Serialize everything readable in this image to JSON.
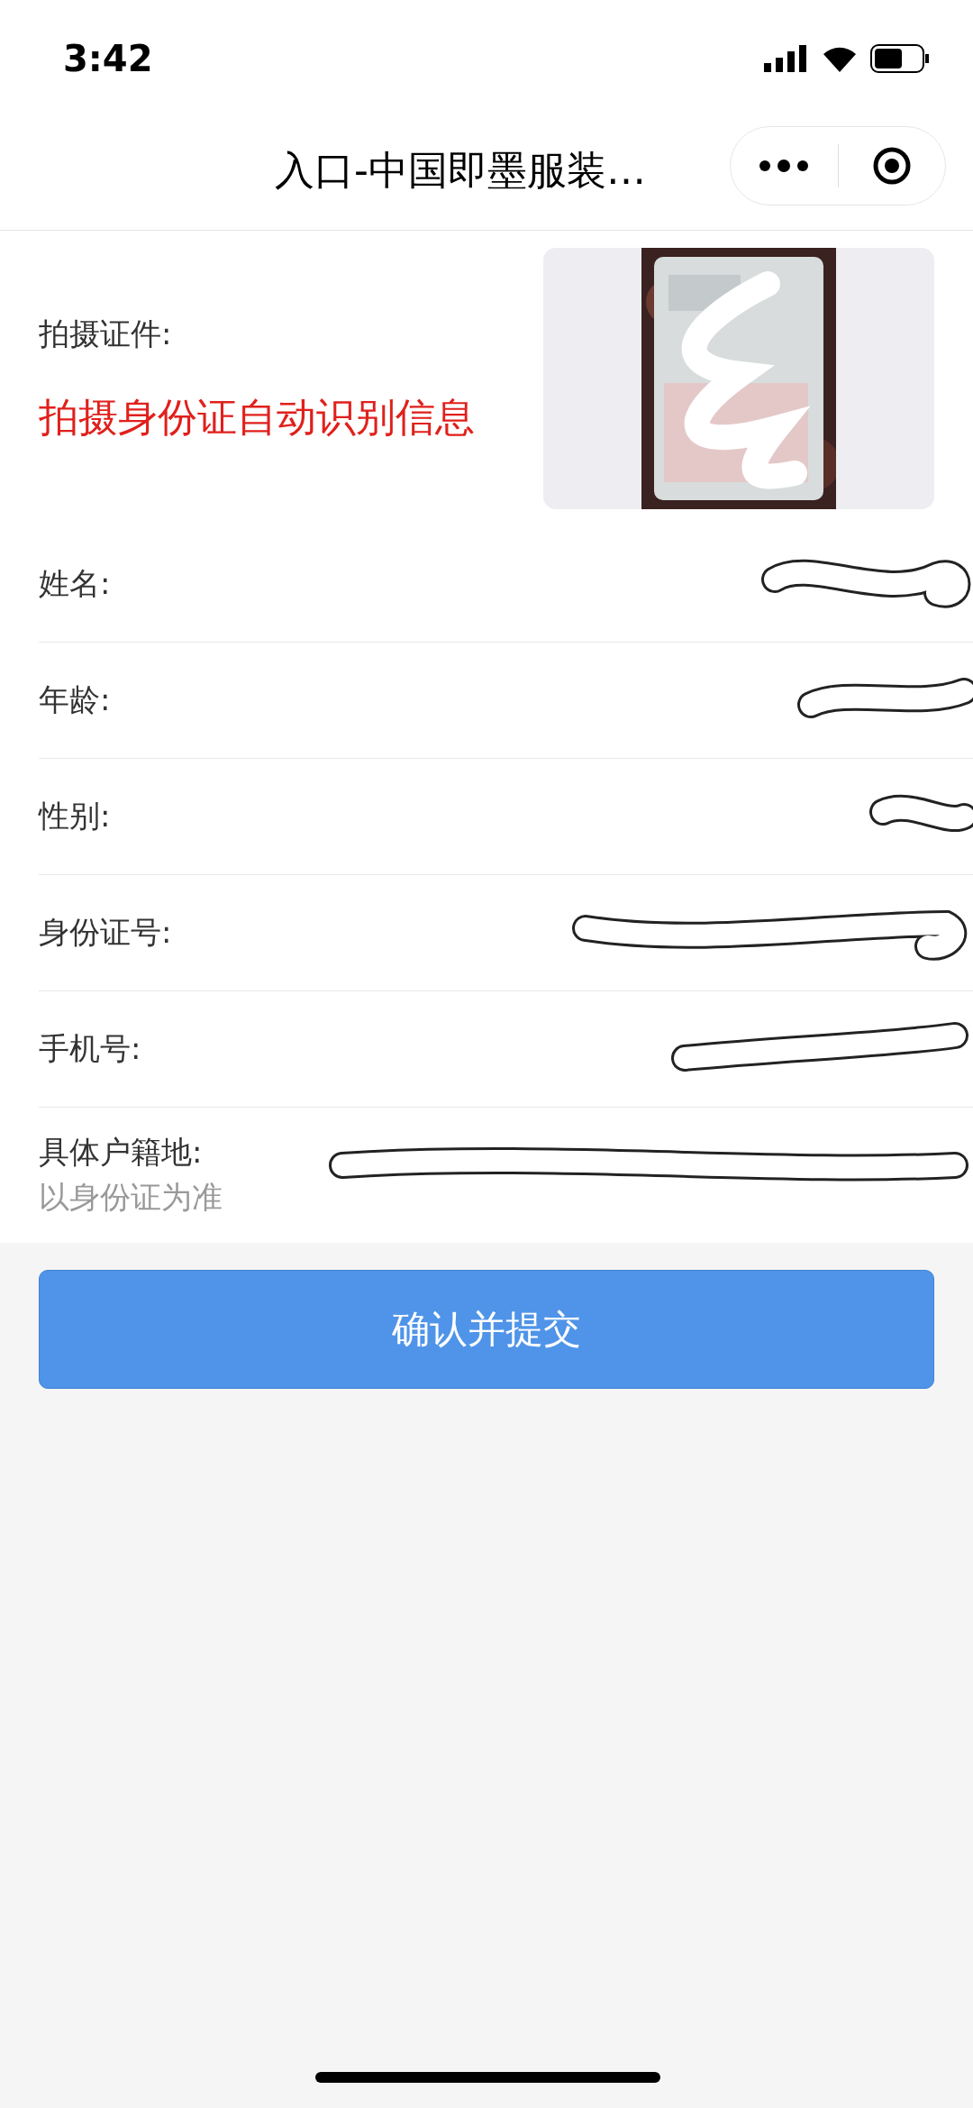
{
  "status_bar": {
    "time": "3:42"
  },
  "nav": {
    "title": "入口-中国即墨服装…"
  },
  "photo_row": {
    "label": "拍摄证件:",
    "hint": "拍摄身份证自动识别信息"
  },
  "fields": [
    {
      "label": "姓名:"
    },
    {
      "label": "年龄:"
    },
    {
      "label": "性别:"
    },
    {
      "label": "身份证号:"
    },
    {
      "label": "手机号:"
    },
    {
      "label": "具体户籍地:",
      "note": "以身份证为准"
    }
  ],
  "submit_button": "确认并提交"
}
